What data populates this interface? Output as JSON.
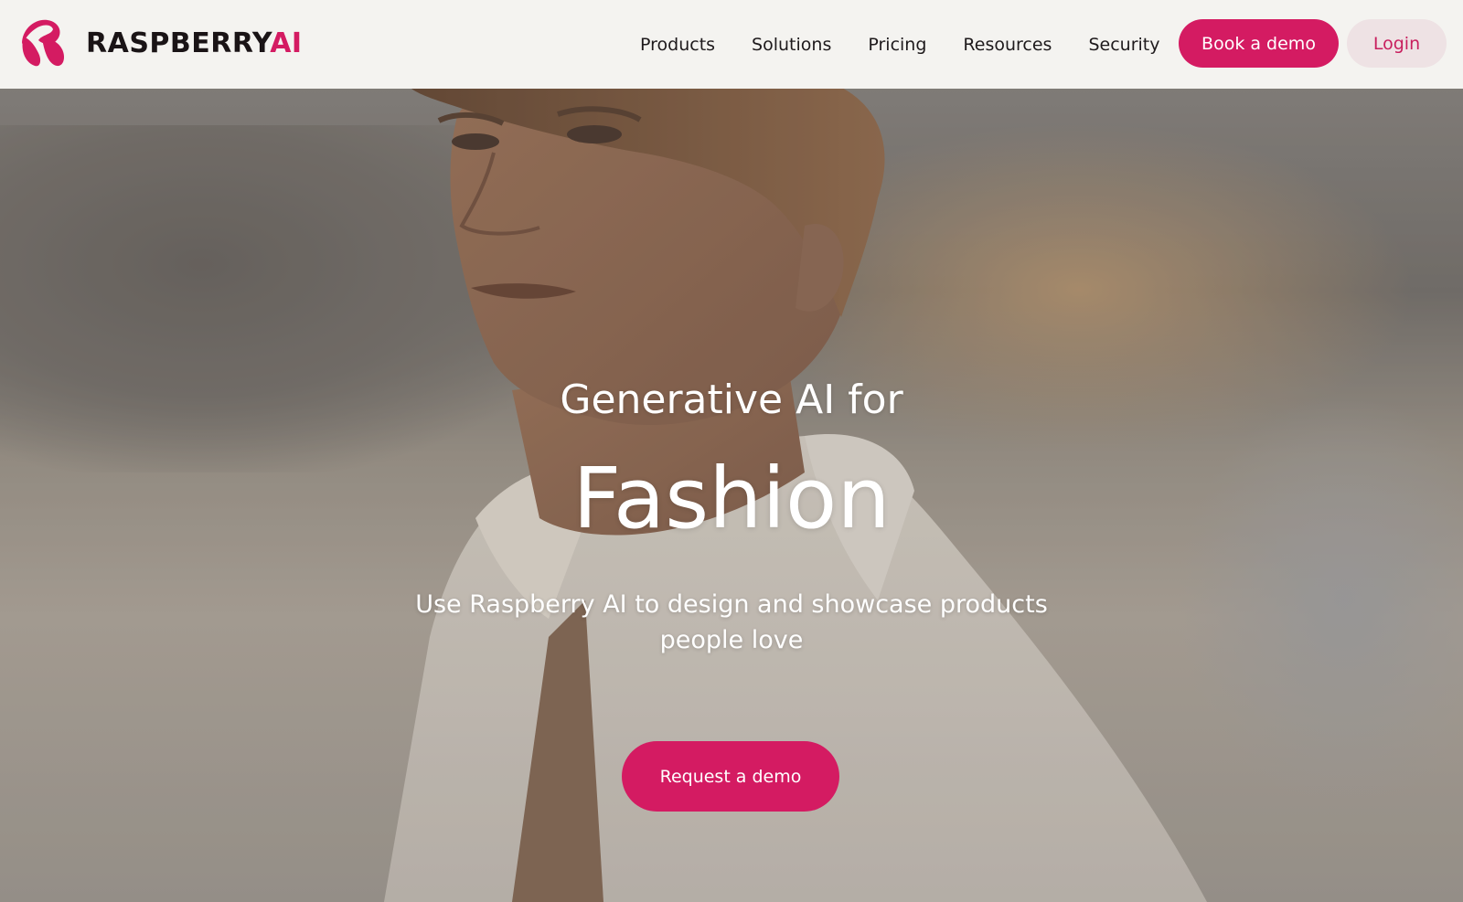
{
  "brand": {
    "name_main": "RASPBERRY",
    "name_accent": "AI",
    "accent_color": "#d41b62",
    "logo_icon": "raspberry-logo-icon"
  },
  "nav": {
    "items": [
      {
        "label": "Products"
      },
      {
        "label": "Solutions"
      },
      {
        "label": "Pricing"
      },
      {
        "label": "Resources"
      },
      {
        "label": "Security"
      }
    ],
    "book_demo_label": "Book a demo",
    "login_label": "Login"
  },
  "hero": {
    "kicker": "Generative AI for",
    "title": "Fashion",
    "subtitle": "Use Raspberry AI to design and showcase products people love",
    "cta_label": "Request a demo"
  }
}
